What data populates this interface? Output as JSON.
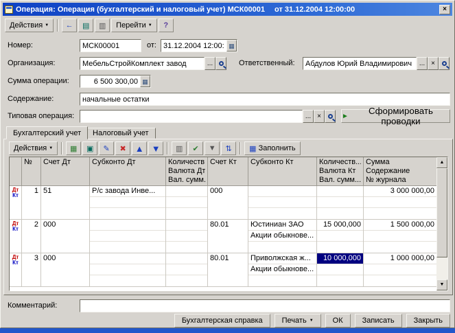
{
  "colors": {
    "titlebar": "#0e41c4",
    "selection": "#000080",
    "accent_green": "#1a7d1a"
  },
  "window": {
    "title_main": "Операция: Операция (бухгалтерский и налоговый учет) МСК00001",
    "title_date": "от 31.12.2004 12:00:00",
    "close": "×"
  },
  "icons": {
    "dropdown": "▼",
    "back": "←",
    "journal": "▤",
    "postings": "▥",
    "help": "?",
    "calendar": "▦",
    "calculator": "▦",
    "add": "▦",
    "copy": "▣",
    "edit": "✎",
    "delete": "✖",
    "move_up": "▲",
    "move_down": "▼",
    "interval": "▥",
    "check": "✔",
    "filter": "▼",
    "sort": "⇅",
    "fill": "▦",
    "play": "►",
    "scroll_up": "▲",
    "scroll_down": "▼",
    "ellipsis": "...",
    "clear": "×"
  },
  "main_toolbar": {
    "actions": "Действия",
    "goto": "Перейти"
  },
  "fields": {
    "number_label": "Номер:",
    "number_value": "МСК00001",
    "date_label": "от:",
    "date_value": "31.12.2004 12:00:00",
    "org_label": "Организация:",
    "org_value": "МебельСтройКомплект завод",
    "resp_label": "Ответственный:",
    "resp_value": "Абдулов Юрий Владимирович",
    "amount_label": "Сумма операции:",
    "amount_value": "6 500 300,00",
    "content_label": "Содержание:",
    "content_value": "начальные остатки",
    "typical_label": "Типовая операция:",
    "typical_value": "",
    "generate": "Сформировать проводки"
  },
  "tabs": {
    "accounting": "Бухгалтерский учет",
    "tax": "Налоговый учет"
  },
  "grid_toolbar": {
    "actions": "Действия",
    "fill": "Заполнить"
  },
  "grid": {
    "dtkt": {
      "dt": "Дт",
      "kt": "Кт"
    },
    "headers": {
      "num": "№",
      "acct_dt": "Счет Дт",
      "sub_dt": "Субконто Дт",
      "qty_dt": [
        "Количеств...",
        "Валюта Дт",
        "Вал. сумм..."
      ],
      "acct_kt": "Счет Кт",
      "sub_kt": "Субконто Кт",
      "qty_kt": [
        "Количеств...",
        "Валюта Кт",
        "Вал. сумм..."
      ],
      "sum": [
        "Сумма",
        "Содержание",
        "№ журнала"
      ]
    },
    "rows": [
      {
        "num": "1",
        "acct_dt": "51",
        "sub_dt": [
          "Р/с завода Инве...",
          "",
          ""
        ],
        "qty_dt": [
          "",
          "",
          ""
        ],
        "acct_kt": "000",
        "sub_kt": [
          "",
          "",
          ""
        ],
        "qty_kt": [
          "",
          "",
          ""
        ],
        "sum": [
          "3 000 000,00",
          "",
          ""
        ]
      },
      {
        "num": "2",
        "acct_dt": "000",
        "sub_dt": [
          "",
          "",
          ""
        ],
        "qty_dt": [
          "",
          "",
          ""
        ],
        "acct_kt": "80.01",
        "sub_kt": [
          "Юстиниан ЗАО",
          "Акции обыкнове...",
          ""
        ],
        "qty_kt": [
          "15 000,000",
          "",
          ""
        ],
        "sum": [
          "1 500 000,00",
          "",
          ""
        ]
      },
      {
        "num": "3",
        "acct_dt": "000",
        "sub_dt": [
          "",
          "",
          ""
        ],
        "qty_dt": [
          "",
          "",
          ""
        ],
        "acct_kt": "80.01",
        "sub_kt": [
          "Приволжская ж...",
          "Акции обыкнове...",
          ""
        ],
        "qty_kt": [
          "10 000,000",
          "",
          ""
        ],
        "sum": [
          "1 000 000,00",
          "",
          ""
        ]
      }
    ]
  },
  "comment": {
    "label": "Комментарий:",
    "value": ""
  },
  "buttons": {
    "accounting_note": "Бухгалтерская справка",
    "print": "Печать",
    "ok": "ОК",
    "save": "Записать",
    "close": "Закрыть"
  }
}
